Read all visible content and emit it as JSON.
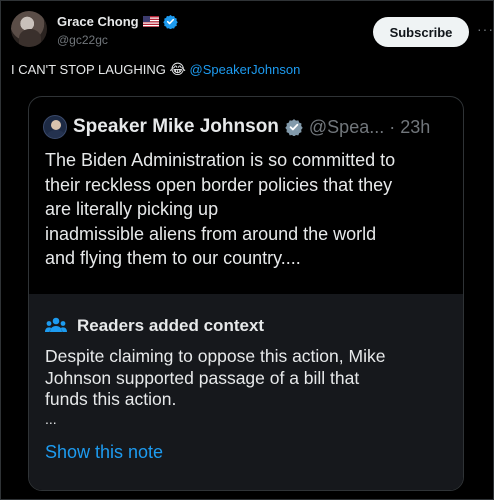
{
  "post": {
    "author": {
      "display_name": "Grace Chong",
      "handle": "@gc22gc",
      "flag_emoji": "🇺🇸"
    },
    "subscribe_label": "Subscribe",
    "more_label": "···",
    "text": "I CAN'T STOP LAUGHING",
    "emoji": "😂",
    "mention": "@SpeakerJohnson"
  },
  "quoted_post": {
    "author": {
      "display_name": "Speaker Mike Johnson",
      "handle_time": "@Spea... · 23h"
    },
    "body_lines": [
      "The Biden Administration is so committed to",
      "their reckless open border policies that they",
      "are literally picking up",
      "inadmissible aliens from around the world",
      "and flying them to our country...."
    ]
  },
  "community_note": {
    "icon": "people-icon",
    "title": "Readers added context",
    "body_lines": [
      "Despite claiming to oppose this action, Mike",
      "Johnson supported passage of a bill that",
      "funds this action."
    ],
    "ellipsis": "...",
    "show_note_label": "Show this note"
  },
  "colors": {
    "background": "#000000",
    "text": "#e7e9ea",
    "secondary": "#71767b",
    "accent": "#1d9bf0",
    "border": "#2f3336",
    "note_background": "#16181c"
  }
}
